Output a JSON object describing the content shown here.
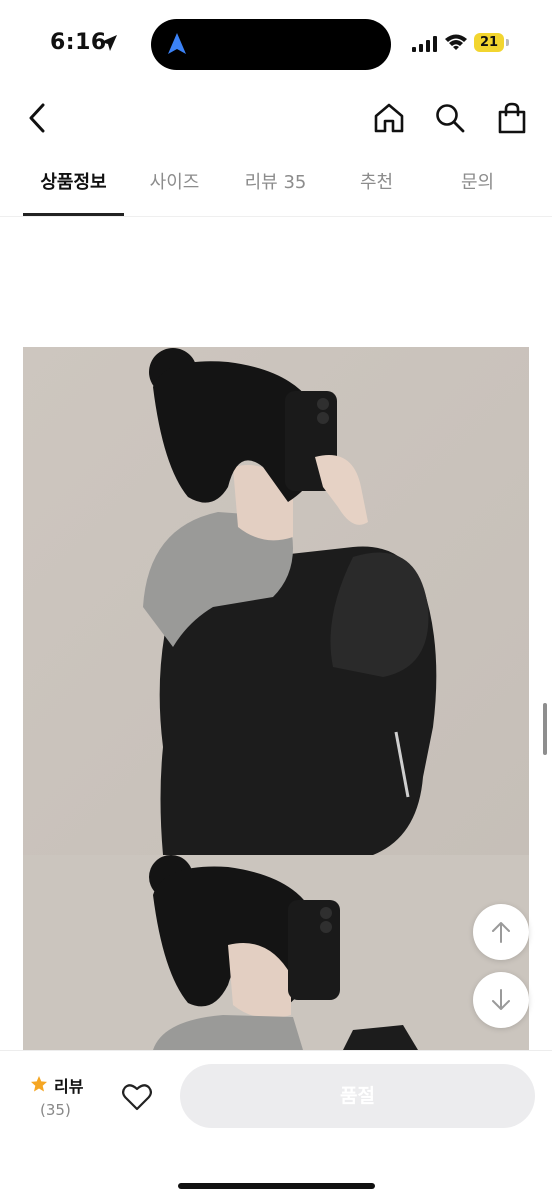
{
  "status": {
    "time": "6:16",
    "battery": "21",
    "battery_color": "#f2d52f"
  },
  "nav": {
    "icons": [
      "back-chevron-icon",
      "home-icon",
      "search-icon",
      "shopping-bag-icon"
    ]
  },
  "tabs": [
    {
      "label": "상품정보",
      "active": true
    },
    {
      "label": "사이즈",
      "active": false
    },
    {
      "label": "리뷰 35",
      "active": false
    },
    {
      "label": "추천",
      "active": false
    },
    {
      "label": "문의",
      "active": false
    }
  ],
  "floating": {
    "icons": [
      "arrow-up-icon",
      "arrow-down-icon"
    ]
  },
  "bottom": {
    "review_label": "리뷰",
    "review_count": "(35)",
    "star_color": "#f5a623",
    "buy_button": "품절"
  }
}
